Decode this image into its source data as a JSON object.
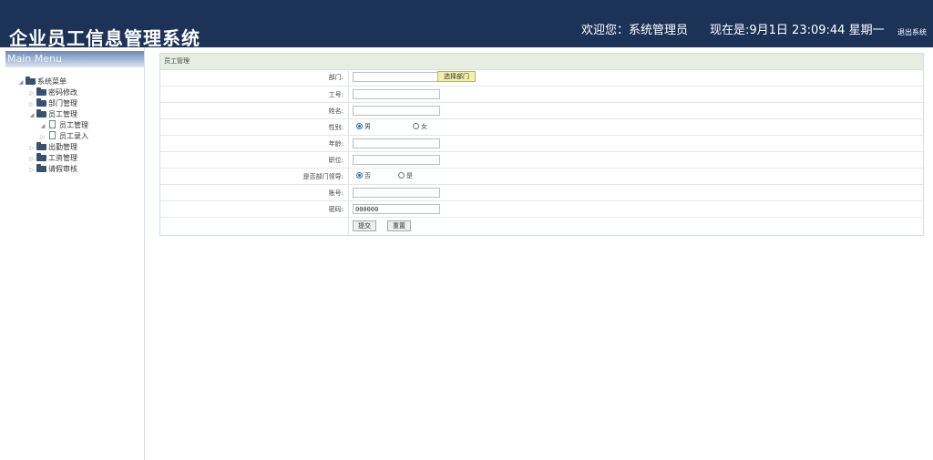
{
  "header": {
    "title": "企业员工信息管理系统",
    "welcome": "欢迎您：系统管理员",
    "clock": "现在是:9月1日 23:09:44 星期一",
    "logout": "退出系统",
    "bg_color": "#1d3257"
  },
  "sidebar": {
    "heading": "Main Menu",
    "tree": {
      "root": "系统菜单",
      "password": "密码修改",
      "dept": "部门管理",
      "employee": "员工管理",
      "employee_manage": "员工管理",
      "employee_entry": "员工录入",
      "attendance": "出勤管理",
      "salary": "工资管理",
      "leave": "请假审核"
    }
  },
  "form": {
    "panel_title": "员工管理",
    "dept_label": "部门:",
    "dept_value": "",
    "dept_button": "选择部门",
    "id_label": "工号:",
    "name_label": "姓名:",
    "gender_label": "性别:",
    "gender_options": {
      "male": "男",
      "female": "女"
    },
    "gender_selected": "男",
    "age_label": "年龄:",
    "position_label": "职位:",
    "leader_label": "是否部门领导:",
    "leader_options": {
      "no": "否",
      "yes": "是"
    },
    "leader_selected": "否",
    "account_label": "账号:",
    "password_label": "密码:",
    "password_value": "000000",
    "submit": "提交",
    "reset": "重置",
    "header_color": "#e7eee0",
    "button_color": "#f3f0a8"
  }
}
